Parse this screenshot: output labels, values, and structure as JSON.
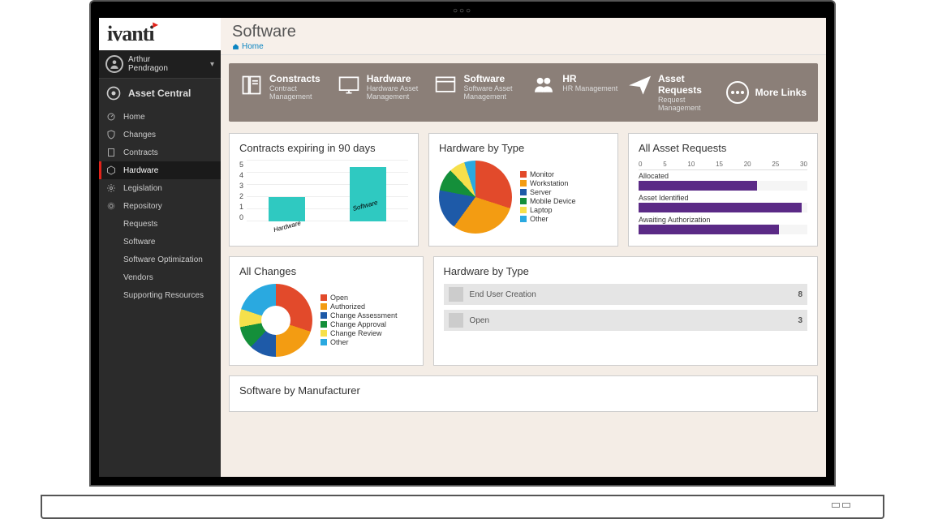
{
  "brand": "ivanti",
  "user": {
    "first": "Arthur",
    "last": "Pendragon"
  },
  "app_section": "Asset Central",
  "nav": [
    {
      "label": "Home",
      "icon": "dashboard"
    },
    {
      "label": "Changes",
      "icon": "shield"
    },
    {
      "label": "Contracts",
      "icon": "doc"
    },
    {
      "label": "Hardware",
      "icon": "cube",
      "active": true
    },
    {
      "label": "Legislation",
      "icon": "gear"
    },
    {
      "label": "Repository",
      "icon": "gear2"
    },
    {
      "label": "Requests",
      "icon": ""
    },
    {
      "label": "Software",
      "icon": ""
    },
    {
      "label": "Software Optimization",
      "icon": ""
    },
    {
      "label": "Vendors",
      "icon": ""
    },
    {
      "label": "Supporting Resources",
      "icon": ""
    }
  ],
  "page": {
    "title": "Software",
    "breadcrumb": "Home"
  },
  "quicklinks": [
    {
      "title": "Constracts",
      "sub": "Contract Management",
      "icon": "contracts"
    },
    {
      "title": "Hardware",
      "sub": "Hardware Asset Management",
      "icon": "monitor"
    },
    {
      "title": "Software",
      "sub": "Software Asset Management",
      "icon": "window"
    },
    {
      "title": "HR",
      "sub": "HR Management",
      "icon": "people"
    },
    {
      "title": "Asset Requests",
      "sub": "Request Management",
      "icon": "send"
    }
  ],
  "more_links_label": "More Links",
  "panels": {
    "contracts90": {
      "title": "Contracts expiring in 90 days"
    },
    "hw_type_pie": {
      "title": "Hardware by Type"
    },
    "requests": {
      "title": "All Asset Requests"
    },
    "changes": {
      "title": "All Changes"
    },
    "hw_list": {
      "title": "Hardware by Type"
    },
    "sw_manu": {
      "title": "Software by Manufacturer"
    }
  },
  "hw_list_rows": [
    {
      "label": "End User Creation",
      "count": "8"
    },
    {
      "label": "Open",
      "count": "3"
    }
  ],
  "chart_data": [
    {
      "id": "contracts90",
      "type": "bar",
      "categories": [
        "Hardware",
        "Software"
      ],
      "values": [
        2,
        4.5
      ],
      "ylim": [
        0,
        5
      ],
      "yticks": [
        0,
        1,
        2,
        3,
        4,
        5
      ],
      "color": "#2fc9c1",
      "ylabel": "",
      "xlabel": ""
    },
    {
      "id": "hw_type_pie",
      "type": "pie",
      "series": [
        {
          "name": "Monitor",
          "value": 30,
          "color": "#e24a2b"
        },
        {
          "name": "Workstation",
          "value": 30,
          "color": "#f39c12"
        },
        {
          "name": "Server",
          "value": 18,
          "color": "#1e5aa8"
        },
        {
          "name": "Mobile Device",
          "value": 10,
          "color": "#148f3a"
        },
        {
          "name": "Laptop",
          "value": 7,
          "color": "#f6e04b"
        },
        {
          "name": "Other",
          "value": 5,
          "color": "#2aa9e0"
        }
      ]
    },
    {
      "id": "requests",
      "type": "bar-horizontal",
      "xlim": [
        0,
        30
      ],
      "xticks": [
        0,
        5,
        10,
        15,
        20,
        25,
        30
      ],
      "series": [
        {
          "name": "Allocated",
          "value": 21,
          "color": "#5b2a86"
        },
        {
          "name": "Asset Identified",
          "value": 29,
          "color": "#5b2a86"
        },
        {
          "name": "Awaiting Authorization",
          "value": 25,
          "color": "#5b2a86"
        }
      ]
    },
    {
      "id": "changes",
      "type": "donut",
      "series": [
        {
          "name": "Open",
          "value": 30,
          "color": "#e24a2b"
        },
        {
          "name": "Authorized",
          "value": 20,
          "color": "#f39c12"
        },
        {
          "name": "Change Assessment",
          "value": 12,
          "color": "#1e5aa8"
        },
        {
          "name": "Change Approval",
          "value": 10,
          "color": "#148f3a"
        },
        {
          "name": "Change Review",
          "value": 8,
          "color": "#f6e04b"
        },
        {
          "name": "Other",
          "value": 20,
          "color": "#2aa9e0"
        }
      ]
    }
  ]
}
